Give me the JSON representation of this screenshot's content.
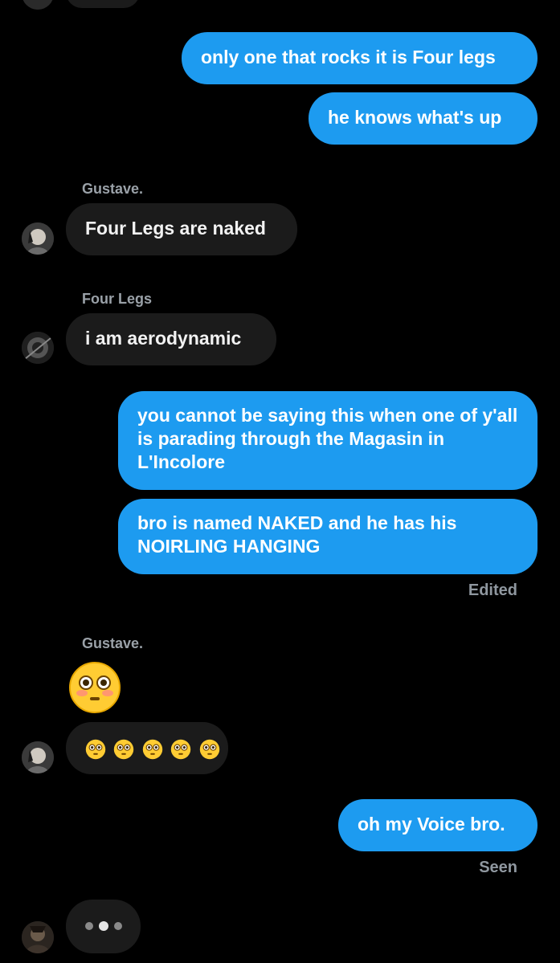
{
  "messages": {
    "m1": "only one that rocks it is Four legs",
    "m2": "he knows what's up",
    "m3_sender": "Gustave.",
    "m3": "Four Legs are naked",
    "m4_sender": "Four Legs",
    "m4": "i am aerodynamic",
    "m5": "you cannot be saying this when one of y'all is parading through the Magasin in L'Incolore",
    "m6": "bro is named NAKED and he has his NOIRLING HANGING",
    "m6_status": "Edited",
    "m7_sender": "Gustave.",
    "m8_emoji_name": "flushed-face-emoji",
    "m9_emoji_names": [
      "flushed-face-emoji",
      "flushed-face-emoji",
      "flushed-face-emoji",
      "flushed-face-emoji",
      "flushed-face-emoji"
    ],
    "m10": "oh my Voice bro.",
    "m10_status": "Seen"
  },
  "colors": {
    "outgoing_bubble": "#1d9bf0",
    "incoming_bubble": "#1b1b1b",
    "background": "#000000"
  },
  "icons": {
    "avatar": "avatar-icon",
    "typing": "typing-indicator-icon"
  }
}
